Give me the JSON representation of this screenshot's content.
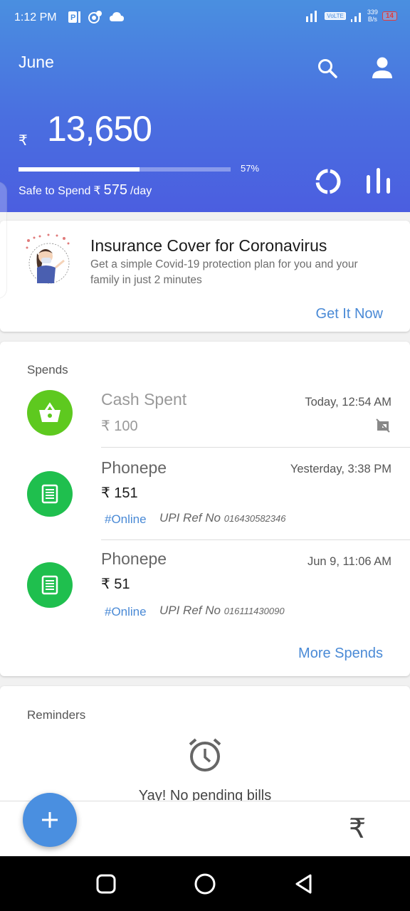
{
  "status_bar": {
    "time": "1:12 PM",
    "network": "VoLTE",
    "speed_value": "339",
    "speed_unit": "B/s",
    "battery": "14"
  },
  "header": {
    "month": "June",
    "currency_symbol": "₹",
    "amount": "13,650",
    "progress_percent": 57,
    "progress_label": "57%",
    "safe_label": "Safe to Spend",
    "safe_currency": "₹",
    "safe_value": "575",
    "safe_unit": "/day",
    "icons": [
      "search-icon",
      "profile-icon",
      "ring-chart-icon",
      "bar-chart-icon"
    ]
  },
  "promo": {
    "title": "Insurance Cover for Coronavirus",
    "subtitle": "Get a simple Covid-19 protection plan for you and your family in just 2 minutes",
    "cta": "Get It Now"
  },
  "spends": {
    "title": "Spends",
    "items": [
      {
        "name": "Cash Spent",
        "amount": "₹ 100",
        "date": "Today, 12:54 AM",
        "icon": "basket-icon",
        "color": "#5ec91f",
        "tag": "",
        "ref_label": "",
        "ref_no": ""
      },
      {
        "name": "Phonepe",
        "amount": "₹ 151",
        "date": "Yesterday, 3:38 PM",
        "icon": "receipt-icon",
        "color": "#1fbf4e",
        "tag": "#Online",
        "ref_label": "UPI Ref No",
        "ref_no": "016430582346"
      },
      {
        "name": "Phonepe",
        "amount": "₹ 51",
        "date": "Jun 9, 11:06 AM",
        "icon": "receipt-icon",
        "color": "#1fbf4e",
        "tag": "#Online",
        "ref_label": "UPI Ref No",
        "ref_no": "016111430090"
      }
    ],
    "more": "More Spends"
  },
  "reminders": {
    "title": "Reminders",
    "empty_text": "Yay! No pending bills"
  },
  "bottom": {
    "fab_label": "+",
    "rupee": "₹"
  },
  "colors": {
    "accent": "#4a8fe0",
    "link": "#4a8ad6",
    "green": "#1fbf4e"
  }
}
